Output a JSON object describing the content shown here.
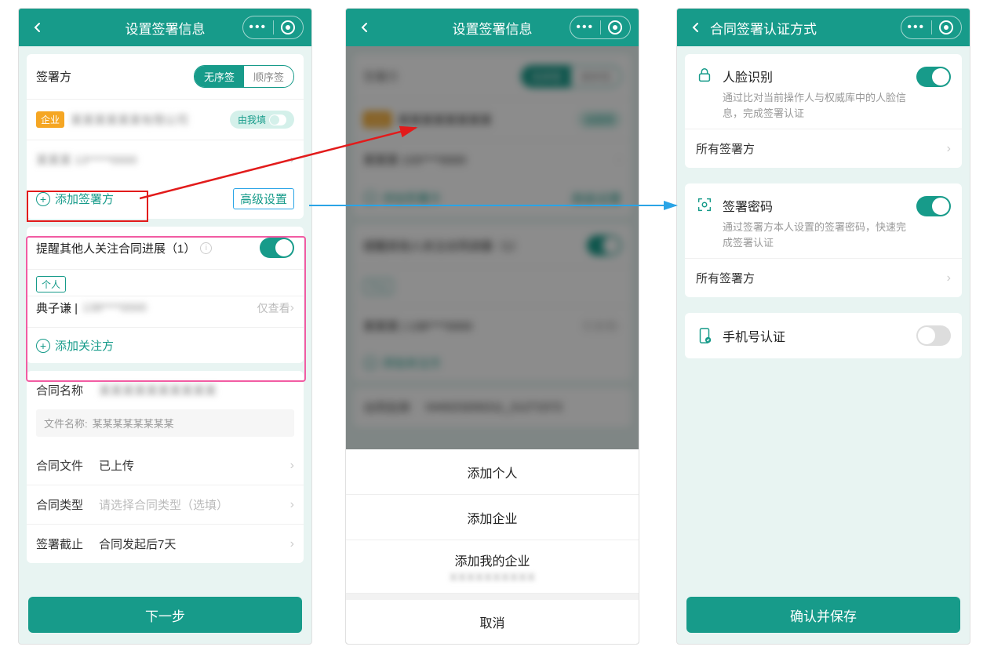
{
  "phone1": {
    "header_title": "设置签署信息",
    "signer_section_title": "签署方",
    "seg_unordered": "无序签",
    "seg_ordered": "顺序签",
    "org_tag": "企业",
    "fill_by_me": "由我填",
    "add_signer": "添加签署方",
    "advanced": "高级设置",
    "follow_title": "提醒其他人关注合同进展（1）",
    "person_tag": "个人",
    "follower_name": "典子谦 |",
    "view_only": "仅查看",
    "add_follower": "添加关注方",
    "contract_name_label": "合同名称",
    "file_name_label": "文件名称:",
    "contract_file_label": "合同文件",
    "contract_file_value": "已上传",
    "contract_type_label": "合同类型",
    "contract_type_placeholder": "请选择合同类型（选填）",
    "deadline_label": "签署截止",
    "deadline_value": "合同发起后7天",
    "next_btn": "下一步"
  },
  "phone2": {
    "header_title": "设置签署信息",
    "contract_name_label": "合同名称",
    "opt_person": "添加个人",
    "opt_company": "添加企业",
    "opt_my_company": "添加我的企业",
    "cancel": "取消"
  },
  "phone3": {
    "header_title": "合同签署认证方式",
    "face_title": "人脸识别",
    "face_desc": "通过比对当前操作人与权威库中的人脸信息，完成签署认证",
    "scope_all": "所有签署方",
    "pwd_title": "签署密码",
    "pwd_desc": "通过签署方本人设置的签署密码，快速完成签署认证",
    "phone_title": "手机号认证",
    "confirm_btn": "确认并保存"
  }
}
